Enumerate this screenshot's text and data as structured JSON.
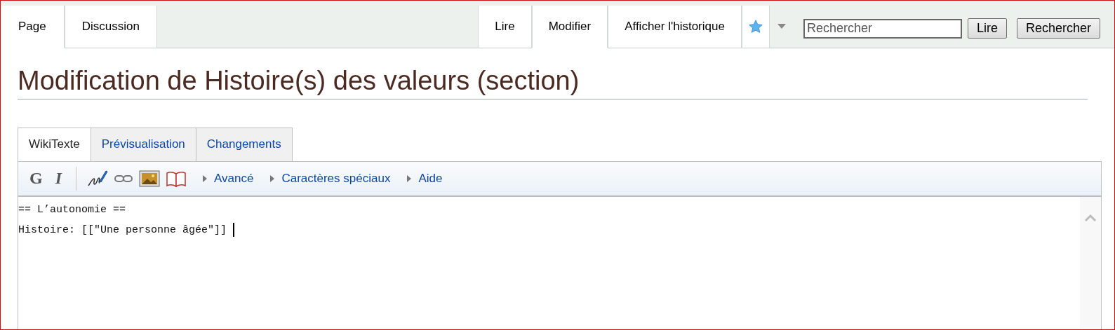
{
  "namespace_tabs": [
    {
      "label": "Page",
      "selected": true
    },
    {
      "label": "Discussion",
      "selected": false
    }
  ],
  "view_tabs": [
    {
      "label": "Lire",
      "selected": false
    },
    {
      "label": "Modifier",
      "selected": true
    },
    {
      "label": "Afficher l'historique",
      "selected": false
    }
  ],
  "watch": {
    "watched": true
  },
  "search": {
    "placeholder": "Rechercher",
    "buttons": [
      "Lire",
      "Rechercher"
    ]
  },
  "heading": "Modification de Histoire(s) des valeurs (section)",
  "editor": {
    "tabs": [
      {
        "label": "WikiTexte",
        "selected": true
      },
      {
        "label": "Prévisualisation",
        "selected": false
      },
      {
        "label": "Changements",
        "selected": false
      }
    ],
    "toolbar": [
      {
        "kind": "bold",
        "label": "G"
      },
      {
        "kind": "italic",
        "label": "I"
      },
      {
        "kind": "signature"
      },
      {
        "kind": "link"
      },
      {
        "kind": "image"
      },
      {
        "kind": "reference"
      }
    ],
    "sections": [
      "Avancé",
      "Caractères spéciaux",
      "Aide"
    ],
    "lines": [
      "== L’autonomie ==",
      "Histoire: [[\"Une personne âgée\"]] "
    ]
  }
}
